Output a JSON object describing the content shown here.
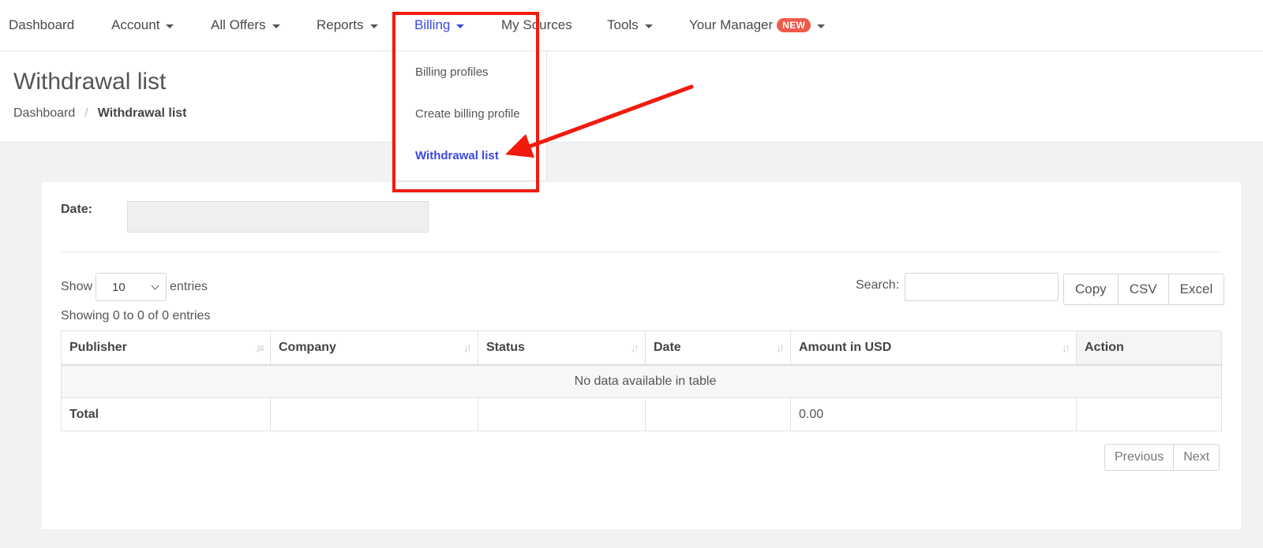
{
  "nav": {
    "items": [
      {
        "label": "Dashboard",
        "dropdown": false
      },
      {
        "label": "Account",
        "dropdown": true
      },
      {
        "label": "All Offers",
        "dropdown": true
      },
      {
        "label": "Reports",
        "dropdown": true
      },
      {
        "label": "Billing",
        "dropdown": true,
        "active": true
      },
      {
        "label": "My Sources",
        "dropdown": false
      },
      {
        "label": "Tools",
        "dropdown": true
      },
      {
        "label": "Your Manager",
        "dropdown": true,
        "badge": "NEW"
      }
    ]
  },
  "billing_menu": {
    "items": [
      {
        "label": "Billing profiles"
      },
      {
        "label": "Create billing profile"
      },
      {
        "label": "Withdrawal list",
        "active": true
      }
    ]
  },
  "page": {
    "title": "Withdrawal list",
    "breadcrumb": {
      "home": "Dashboard",
      "separator": "/",
      "current": "Withdrawal list"
    }
  },
  "filters": {
    "date_label": "Date:",
    "date_value": ""
  },
  "table_controls": {
    "show_label": "Show",
    "entries_label": "entries",
    "page_length": "10",
    "search_label": "Search:",
    "search_value": "",
    "export_buttons": [
      "Copy",
      "CSV",
      "Excel"
    ],
    "info": "Showing 0 to 0 of 0 entries"
  },
  "table": {
    "columns": [
      "Publisher",
      "Company",
      "Status",
      "Date",
      "Amount in USD",
      "Action"
    ],
    "empty_message": "No data available in table",
    "footer": {
      "label": "Total",
      "amount": "0.00"
    }
  },
  "pagination": {
    "previous": "Previous",
    "next": "Next"
  },
  "colors": {
    "accent": "#3b48e0",
    "annotation": "#f21a0d",
    "badge": "#f05a4a"
  }
}
